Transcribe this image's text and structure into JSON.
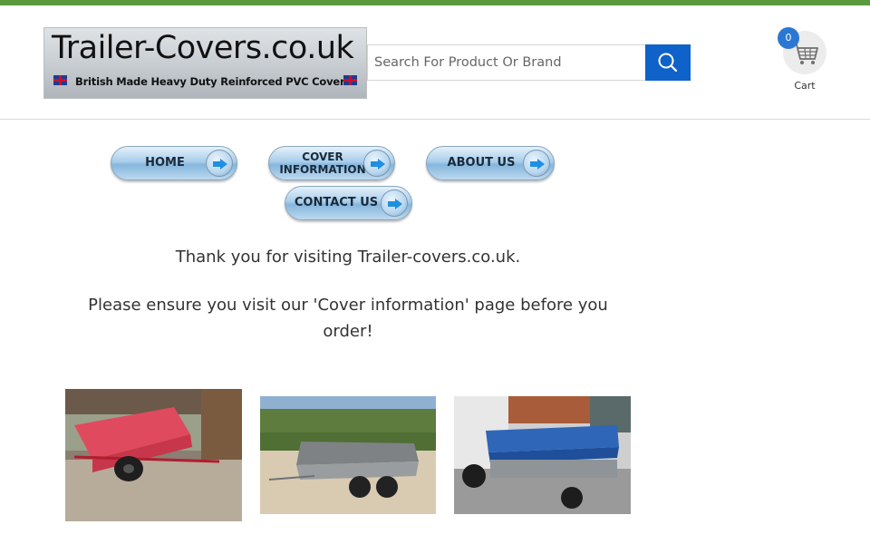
{
  "header": {
    "logo": {
      "title": "Trailer-Covers.co.uk",
      "tagline": "British Made Heavy Duty Reinforced PVC Covers"
    },
    "search": {
      "placeholder": "Search For Product Or Brand",
      "value": ""
    },
    "cart": {
      "count": "0",
      "label": "Cart"
    }
  },
  "nav": {
    "home": "HOME",
    "cover_info": "COVER INFORMATION",
    "about": "ABOUT US",
    "contact": "CONTACT US"
  },
  "content": {
    "thank_you": "Thank you for visiting Trailer-covers.co.uk.",
    "notice": "Please ensure you visit our 'Cover information' page before you order!"
  },
  "colors": {
    "top_bar": "#5b9a3d",
    "search_button": "#0f62c9",
    "cart_badge": "#2b78d4"
  },
  "icons": {
    "search": "search-icon",
    "cart": "shopping-cart-icon",
    "nav_arrow": "arrow-right-icon"
  }
}
